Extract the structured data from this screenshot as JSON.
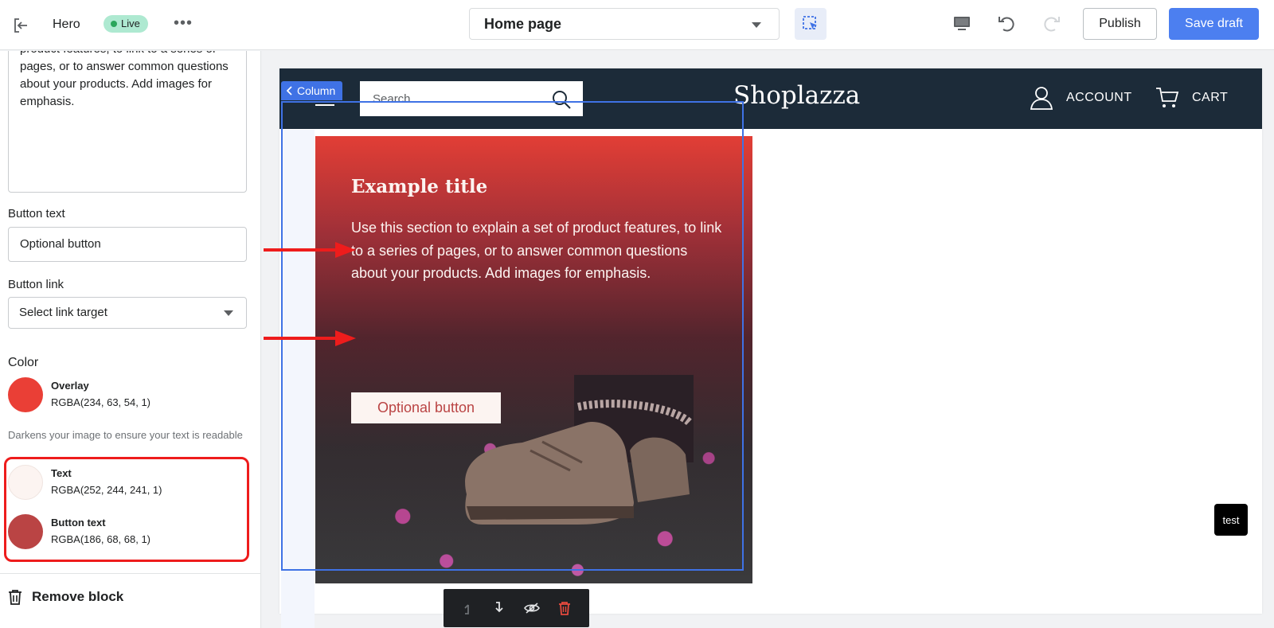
{
  "topbar": {
    "title": "Hero",
    "live_badge": "Live",
    "more": "•••",
    "page_select": "Home page",
    "publish": "Publish",
    "save_draft": "Save draft"
  },
  "sidebar": {
    "description": "product features, to link to a series of pages, or to answer common questions about your products. Add images for emphasis.",
    "button_text_label": "Button text",
    "button_text_value": "Optional button",
    "button_link_label": "Button link",
    "button_link_value": "Select link target",
    "color_heading": "Color",
    "colors": [
      {
        "name": "Overlay",
        "value": "RGBA(234, 63, 54, 1)",
        "hex": "#ea3f36"
      },
      {
        "name": "Text",
        "value": "RGBA(252, 244, 241, 1)",
        "hex": "#fcf4f1"
      },
      {
        "name": "Button text",
        "value": "RGBA(186, 68, 68, 1)",
        "hex": "#ba4444"
      }
    ],
    "overlay_help": "Darkens your image to ensure your text is readable",
    "remove_block": "Remove block"
  },
  "preview": {
    "search_placeholder": "Search...",
    "logo": "Shoplazza",
    "account": "ACCOUNT",
    "cart": "CART",
    "column_tag": "Column",
    "hero_title": "Example title",
    "hero_text": "Use this section to explain a set of product features, to link to a series of pages, or to answer common questions about your products. Add images for emphasis.",
    "hero_button": "Optional button",
    "test_button": "test"
  },
  "colors": {
    "accent": "#4c7ff0",
    "selection": "#3f72e5",
    "header": "#1c2b39",
    "annotation_red": "#ee1c1c"
  }
}
